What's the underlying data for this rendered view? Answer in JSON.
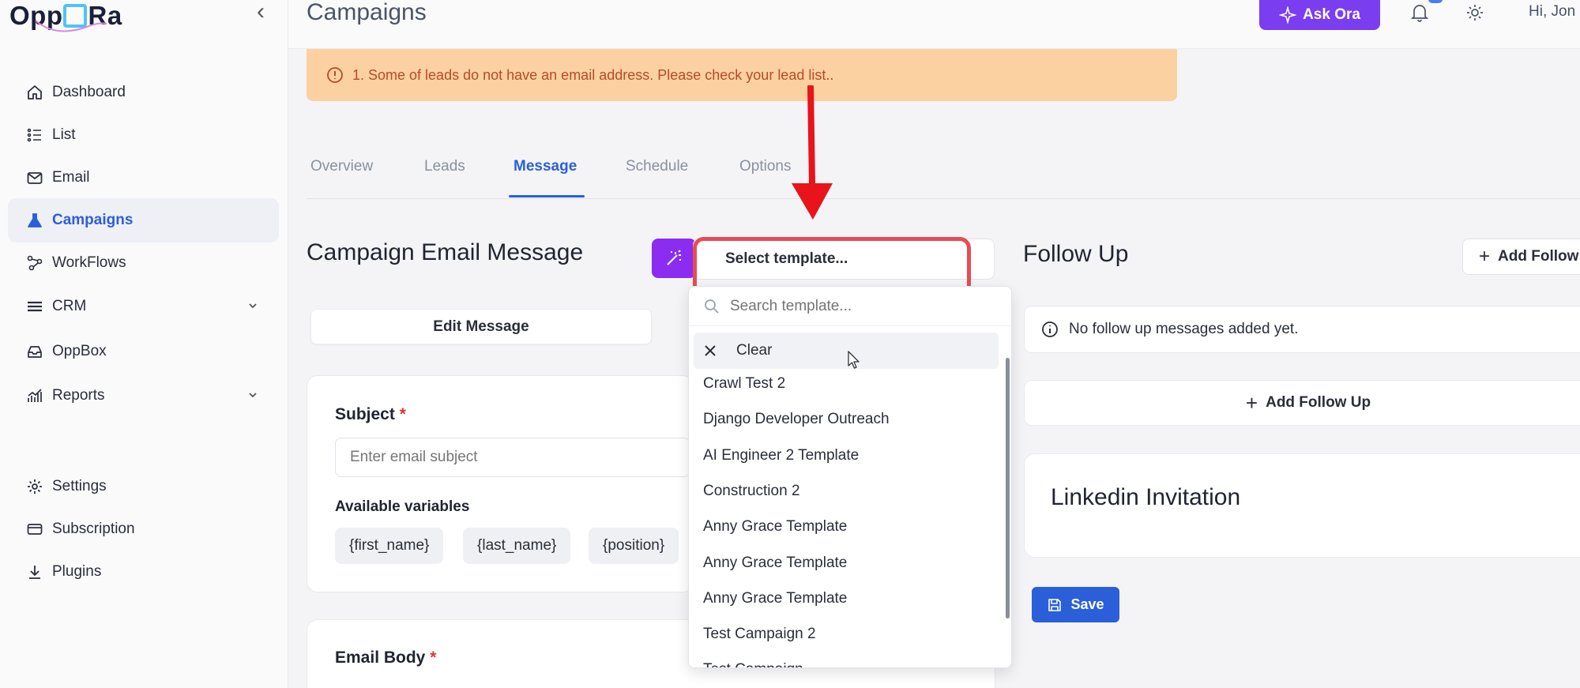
{
  "app": {
    "logo_text_left": "Opp",
    "logo_text_right": "Ra"
  },
  "sidebar": {
    "items": [
      {
        "label": "Dashboard",
        "icon": "home-icon"
      },
      {
        "label": "List",
        "icon": "list-icon"
      },
      {
        "label": "Email",
        "icon": "mail-icon"
      },
      {
        "label": "Campaigns",
        "icon": "flask-icon",
        "active": true
      },
      {
        "label": "WorkFlows",
        "icon": "workflow-icon"
      },
      {
        "label": "CRM",
        "icon": "crm-icon",
        "expandable": true
      },
      {
        "label": "OppBox",
        "icon": "inbox-icon"
      },
      {
        "label": "Reports",
        "icon": "chart-icon",
        "expandable": true
      },
      {
        "label": "Settings",
        "icon": "gear-icon"
      },
      {
        "label": "Subscription",
        "icon": "card-icon"
      },
      {
        "label": "Plugins",
        "icon": "download-icon"
      }
    ]
  },
  "header": {
    "title": "Campaigns",
    "ask_label": "Ask Ora",
    "greeting": "Hi, Jon"
  },
  "alert": {
    "text": "1. Some of leads do not have an email address. Please check your lead list.."
  },
  "tabs": [
    {
      "label": "Overview"
    },
    {
      "label": "Leads"
    },
    {
      "label": "Message",
      "active": true
    },
    {
      "label": "Schedule"
    },
    {
      "label": "Options"
    }
  ],
  "email": {
    "section_title": "Campaign Email Message",
    "template_select_value": "Select template...",
    "edit_message_label": "Edit Message",
    "subject_label": "Subject",
    "required_mark": "*",
    "subject_placeholder": "Enter email subject",
    "variables_label": "Available variables",
    "variables": [
      "{first_name}",
      "{last_name}",
      "{position}"
    ],
    "body_label": "Email Body"
  },
  "template_dropdown": {
    "search_placeholder": "Search template...",
    "clear_label": "Clear",
    "options": [
      "Crawl Test 2",
      "Django Developer Outreach",
      "AI Engineer 2 Template",
      "Construction 2",
      "Anny Grace Template",
      "Anny Grace Template",
      "Anny Grace Template",
      "Test Campaign 2",
      "Test Campaign"
    ]
  },
  "follow_up": {
    "title": "Follow Up",
    "add_top_label": "Add Follow",
    "empty_text": "No follow up messages added yet.",
    "add_label": "Add Follow Up",
    "linkedin_title": "Linkedin Invitation",
    "save_label": "Save"
  },
  "colors": {
    "accent": "#2b5fd9",
    "ask_button": "#7b3df0",
    "magic_button": "#8b2cf0",
    "alert_bg": "#fbd1a2",
    "alert_text": "#b84a2a",
    "annotation_red": "#e94b55"
  }
}
